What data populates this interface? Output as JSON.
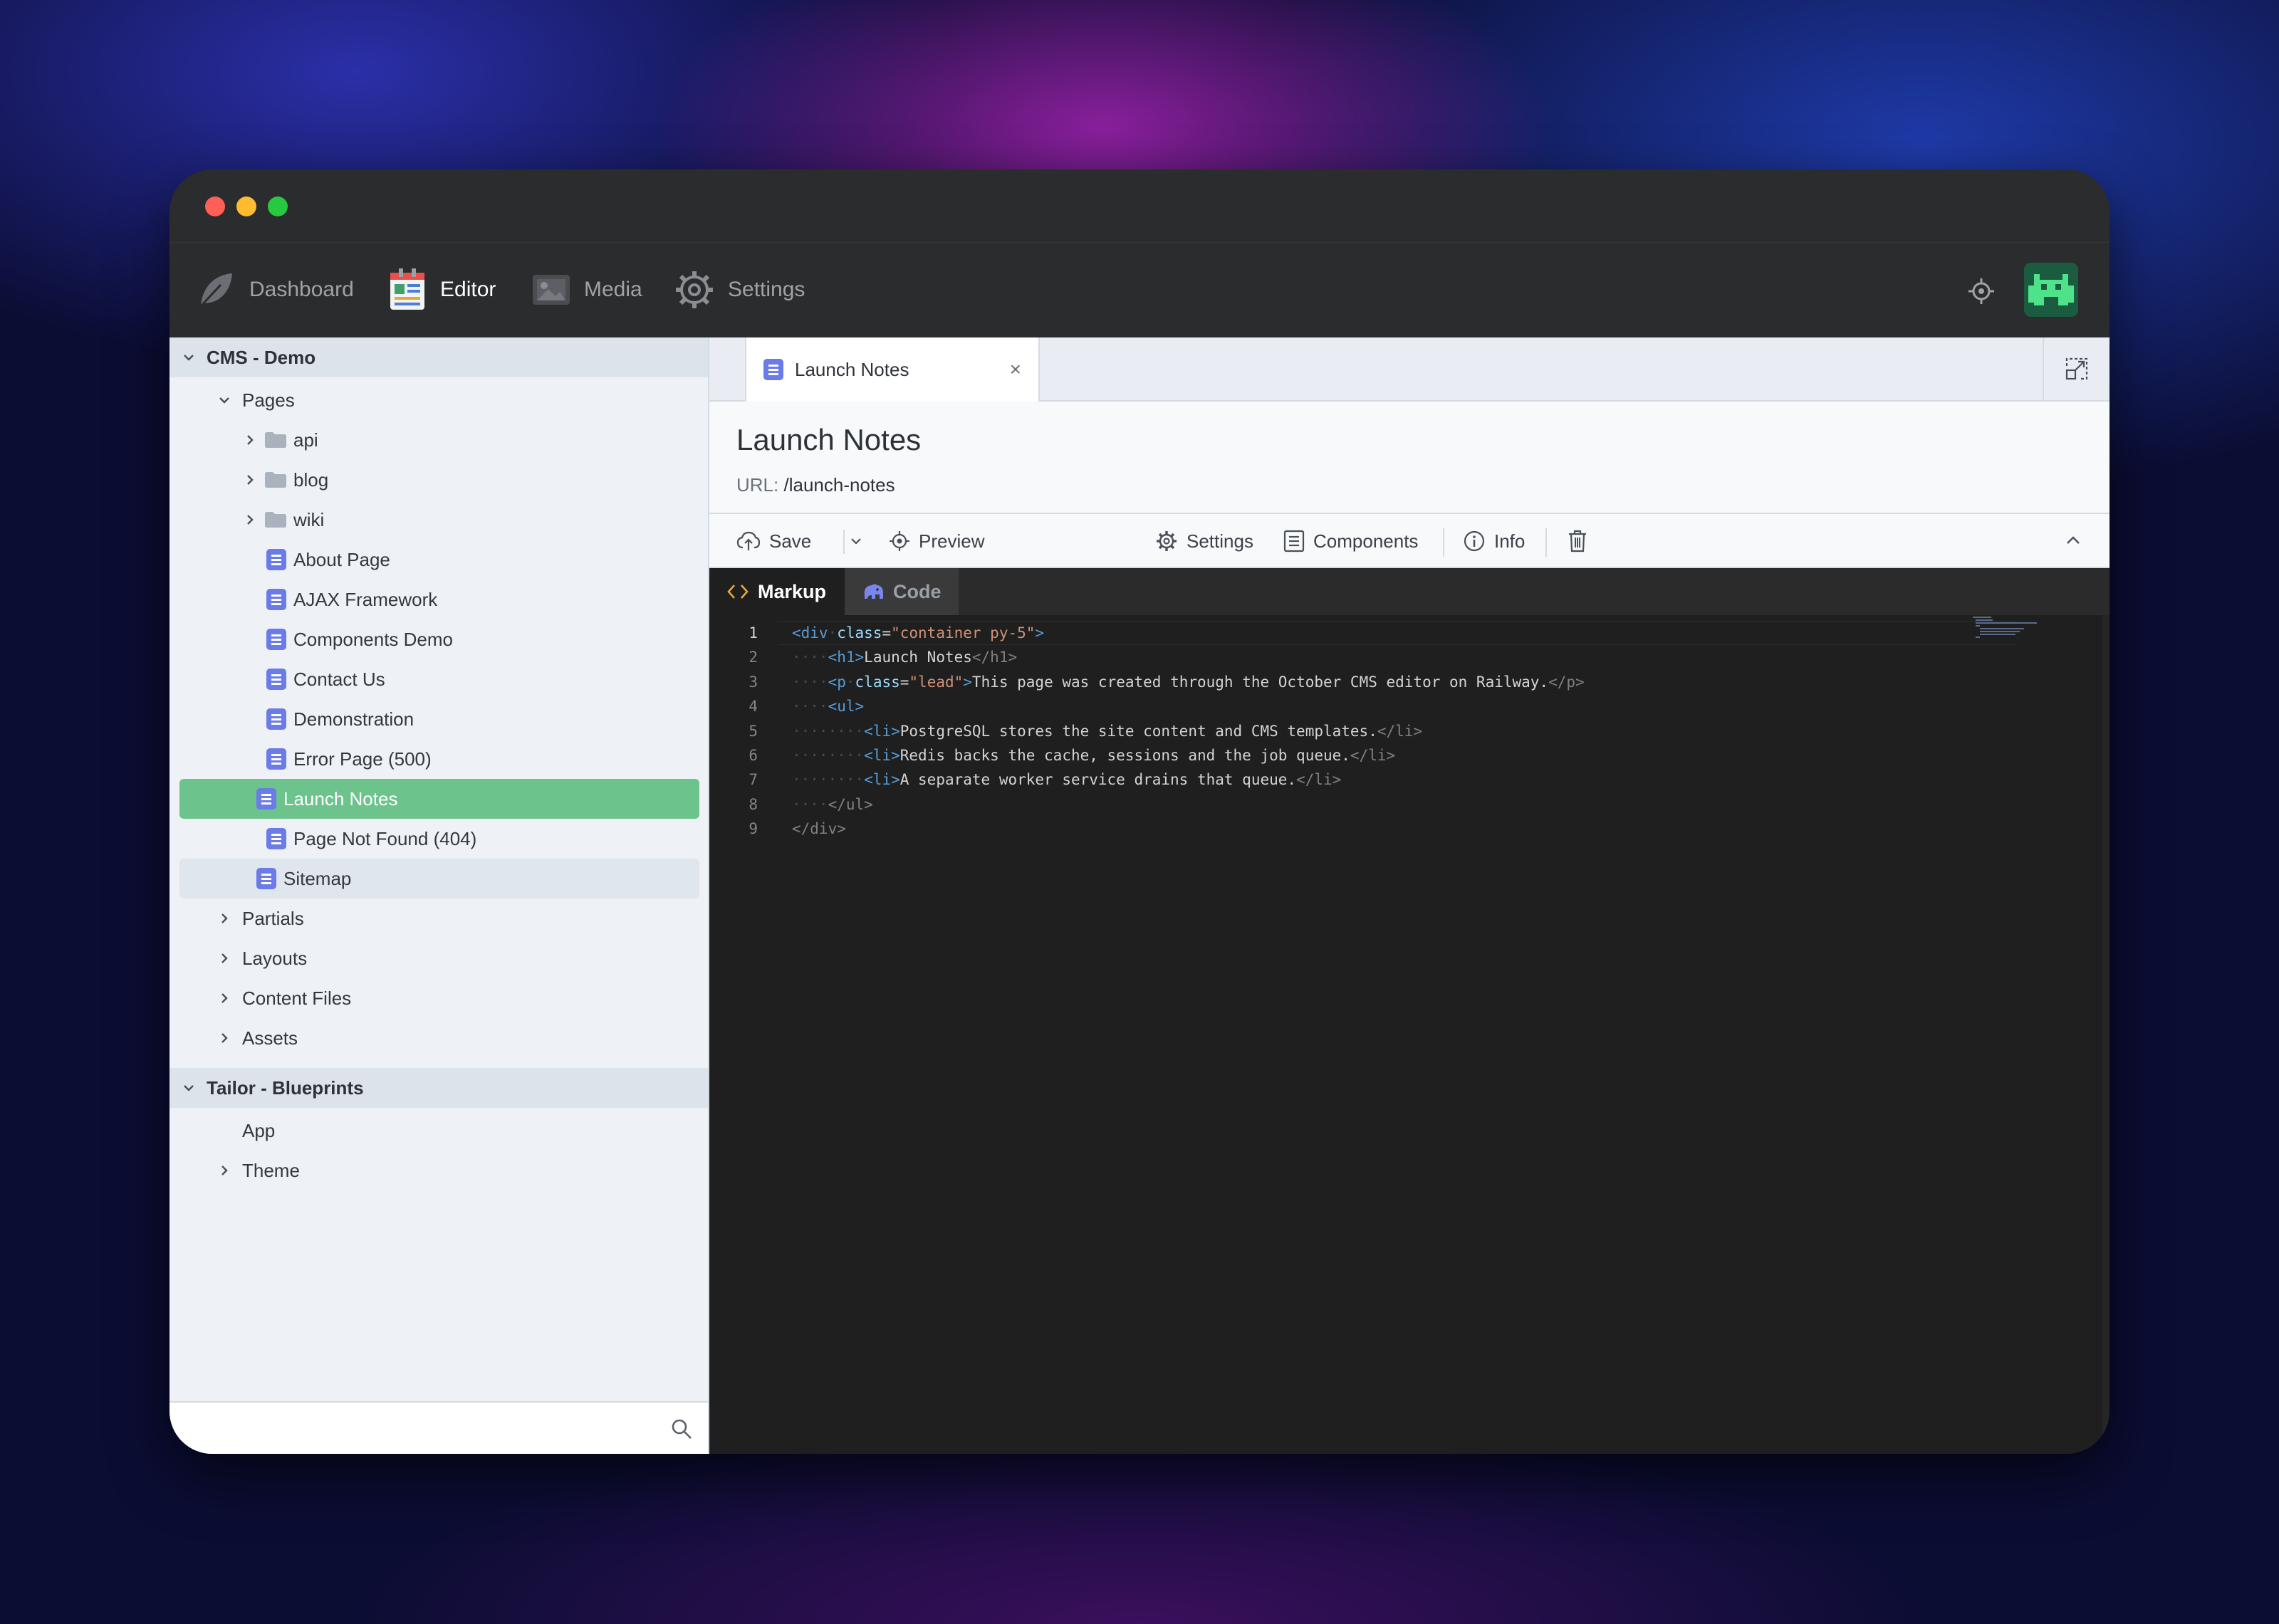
{
  "window": {
    "traffic_lights": [
      "close",
      "minimize",
      "maximize"
    ]
  },
  "topnav": {
    "items": [
      {
        "label": "Dashboard",
        "icon": "leaf-icon",
        "active": false
      },
      {
        "label": "Editor",
        "icon": "editor-icon",
        "active": true
      },
      {
        "label": "Media",
        "icon": "media-icon",
        "active": false
      },
      {
        "label": "Settings",
        "icon": "gear-icon",
        "active": false
      }
    ]
  },
  "sidebar": {
    "sections": [
      {
        "title": "CMS - Demo"
      },
      {
        "title": "Tailor - Blueprints"
      }
    ],
    "cms": {
      "pages_label": "Pages",
      "folders": [
        "api",
        "blog",
        "wiki"
      ],
      "pages": [
        "About Page",
        "AJAX Framework",
        "Components Demo",
        "Contact Us",
        "Demonstration",
        "Error Page (500)",
        "Launch Notes",
        "Page Not Found (404)",
        "Sitemap"
      ],
      "selected": "Launch Notes",
      "groups": [
        "Partials",
        "Layouts",
        "Content Files",
        "Assets"
      ]
    },
    "tailor": {
      "items": [
        "App",
        "Theme"
      ]
    },
    "search": {
      "placeholder": ""
    }
  },
  "main": {
    "tab": {
      "label": "Launch Notes",
      "close": "×"
    },
    "page": {
      "title": "Launch Notes",
      "url_label": "URL:",
      "url": "/launch-notes"
    },
    "toolbar": {
      "save": "Save",
      "preview": "Preview",
      "settings": "Settings",
      "components": "Components",
      "info": "Info"
    },
    "code_tabs": {
      "markup": "Markup",
      "code": "Code",
      "active": "Markup"
    },
    "editor": {
      "current_line": 1,
      "line_numbers": [
        "1",
        "2",
        "3",
        "4",
        "5",
        "6",
        "7",
        "8",
        "9"
      ],
      "lines": [
        "<div class=\"container py-5\">",
        "    <h1>Launch Notes</h1>",
        "    <p class=\"lead\">This page was created through the October CMS editor on Railway.</p>",
        "    <ul>",
        "        <li>PostgreSQL stores the site content and CMS templates.</li>",
        "        <li>Redis backs the cache, sessions and the job queue.</li>",
        "        <li>A separate worker service drains that queue.</li>",
        "    </ul>",
        "</div>"
      ]
    }
  },
  "colors": {
    "selected_row": "#6cc38b",
    "page_icon": "#6b7be8",
    "tag": "#569cd6",
    "attr": "#9cdcfe",
    "string": "#ce9178"
  }
}
